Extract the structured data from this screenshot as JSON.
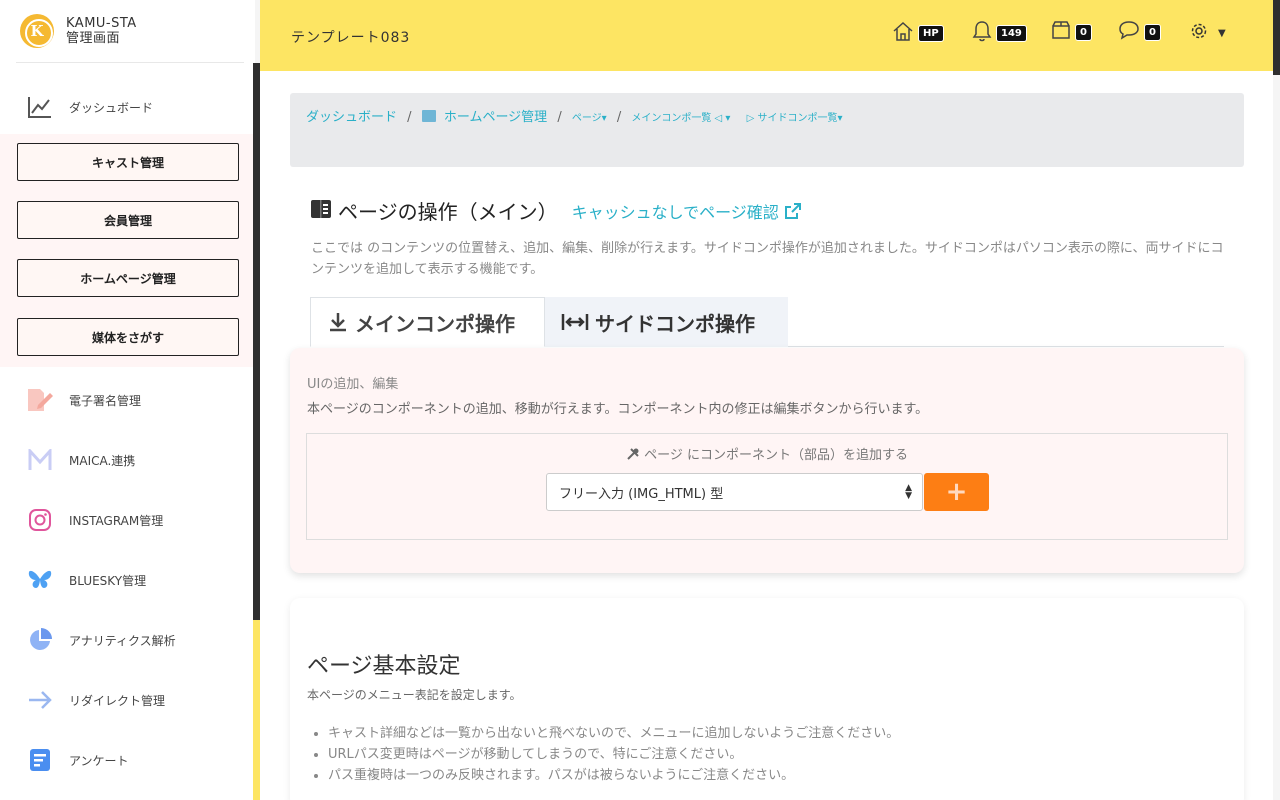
{
  "brand": {
    "logo_letter": "K",
    "line1": "KAMU-STA",
    "line2": "管理画面"
  },
  "sidebar": {
    "dashboard": "ダッシュボード",
    "group_buttons": [
      "キャスト管理",
      "会員管理",
      "ホームページ管理",
      "媒体をさがす"
    ],
    "items": [
      {
        "label": "電子署名管理",
        "icon": "pen-document-icon"
      },
      {
        "label": "MAICA.連携",
        "icon": "m-logo-icon"
      },
      {
        "label": "INSTAGRAM管理",
        "icon": "instagram-icon"
      },
      {
        "label": "BLUESKY管理",
        "icon": "butterfly-icon"
      },
      {
        "label": "アナリティクス解析",
        "icon": "pie-chart-icon"
      },
      {
        "label": "リダイレクト管理",
        "icon": "arrow-right-icon"
      },
      {
        "label": "アンケート",
        "icon": "form-icon"
      }
    ]
  },
  "header": {
    "title": "テンプレート083",
    "home_badge": "HP",
    "notifications": "149",
    "box_count": "0",
    "messages": "0"
  },
  "breadcrumb": {
    "dashboard": "ダッシュボード",
    "homepage": "ホームページ管理",
    "page": "ページ",
    "main_list": "メインコンポ一覧",
    "side_list": "サイドコンポ一覧"
  },
  "page": {
    "title": "ページの操作（メイン）",
    "cache_link": "キャッシュなしでページ確認",
    "description": "ここでは のコンテンツの位置替え、追加、編集、削除が行えます。サイドコンポ操作が追加されました。サイドコンポはパソコン表示の際に、両サイドにコンテンツを追加して表示する機能です。"
  },
  "tabs": {
    "main": "メインコンポ操作",
    "side": "サイドコンポ操作"
  },
  "ui_card": {
    "subtitle": "UIの追加、編集",
    "note": "本ページのコンポーネントの追加、移動が行えます。コンポーネント内の修正は編集ボタンから行います。",
    "add_label": "ページ にコンポーネント（部品）を追加する",
    "select_value": "フリー入力 (IMG_HTML) 型",
    "add_button": "+"
  },
  "basic_card": {
    "title": "ページ基本設定",
    "lead": "本ページのメニュー表記を設定します。",
    "bullets": [
      "キャスト詳細などは一覧から出ないと飛べないので、メニューに追加しないようご注意ください。",
      "URLパス変更時はページが移動してしまうので、特にご注意ください。",
      "パス重複時は一つのみ反映されます。パスがは被らないようにご注意ください。"
    ]
  },
  "colors": {
    "header_bg": "#fde563",
    "link": "#2ab0c8",
    "add_button": "#fd7e14"
  }
}
